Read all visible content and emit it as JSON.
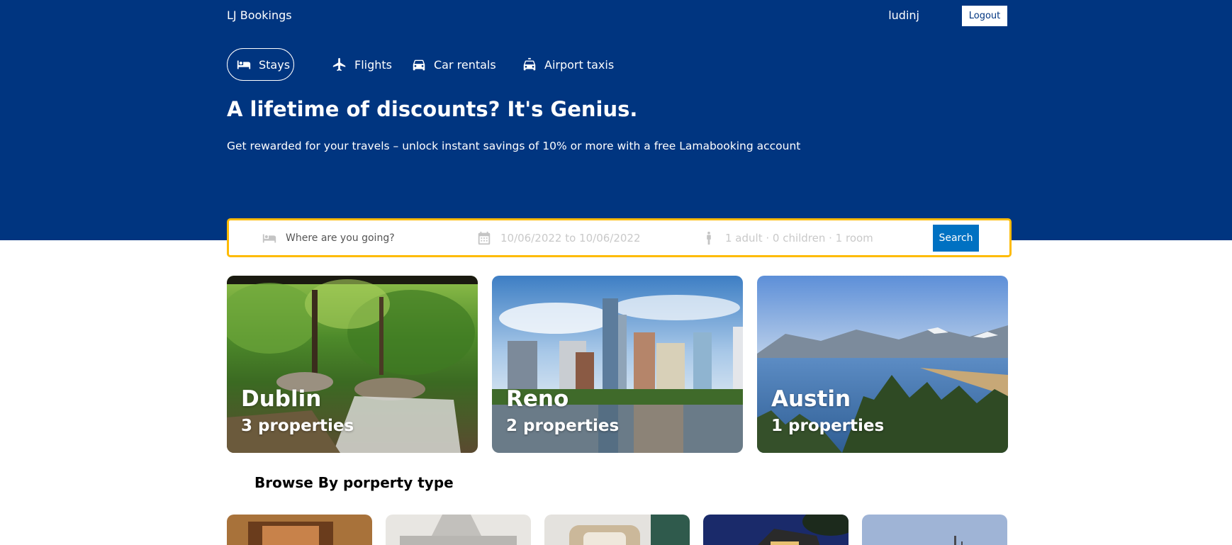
{
  "navbar": {
    "logo": "LJ Bookings",
    "username": "ludinj",
    "logout_label": "Logout"
  },
  "tabs": [
    {
      "label": "Stays",
      "icon": "bed-icon",
      "active": true
    },
    {
      "label": "Flights",
      "icon": "plane-icon",
      "active": false
    },
    {
      "label": "Car rentals",
      "icon": "car-icon",
      "active": false
    },
    {
      "label": "Airport taxis",
      "icon": "taxi-icon",
      "active": false
    }
  ],
  "hero": {
    "title": "A lifetime of discounts? It's Genius.",
    "subtitle": "Get rewarded for your travels – unlock instant savings of 10% or more with a free Lamabooking account"
  },
  "search": {
    "destination_placeholder": "Where are you going?",
    "dates": "10/06/2022 to 10/06/2022",
    "guests": "1 adult · 0 children · 1 room",
    "button_label": "Search"
  },
  "featured": [
    {
      "city": "Dublin",
      "count": "3 properties",
      "image": "forest-stream"
    },
    {
      "city": "Reno",
      "count": "2 properties",
      "image": "city-skyline"
    },
    {
      "city": "Austin",
      "count": "1 properties",
      "image": "lake-mountains"
    }
  ],
  "property_types": {
    "title": "Browse By porperty type",
    "items": [
      "hotel-photo",
      "apartment-photo",
      "resort-photo",
      "villa-photo",
      "cabin-photo"
    ]
  },
  "colors": {
    "brand_blue": "#003580",
    "search_border": "#febb02",
    "button_blue": "#0071c2"
  }
}
